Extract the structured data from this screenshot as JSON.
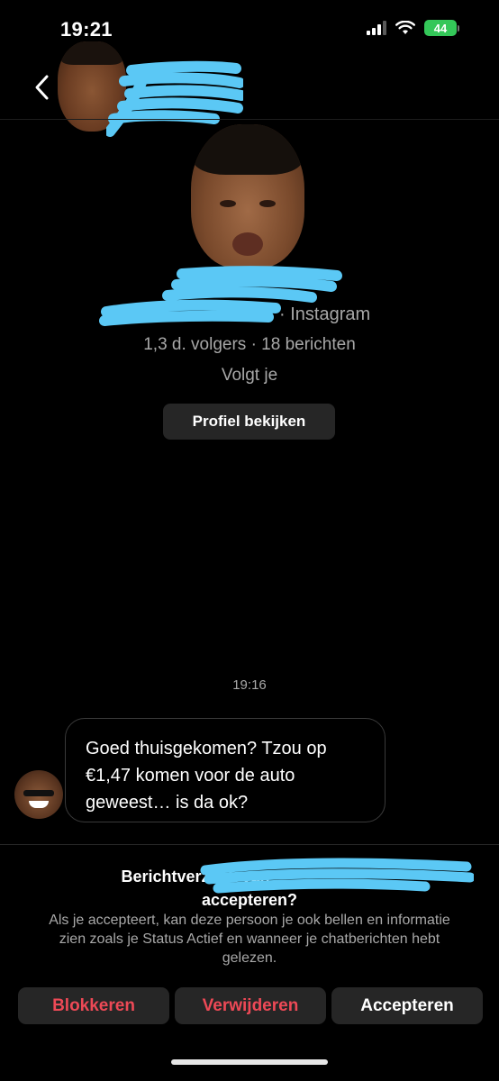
{
  "status_bar": {
    "time": "19:21",
    "battery": "44"
  },
  "profile": {
    "platform": "· Instagram",
    "stats": "1,3 d. volgers · 18 berichten",
    "follows_you": "Volgt je",
    "view_profile_label": "Profiel bekijken"
  },
  "chat": {
    "timestamp": "19:16",
    "message_lines": [
      "Goed thuisgekomen? Tzou op",
      "€1,47 komen voor de auto",
      "geweest… is da ok?"
    ]
  },
  "request": {
    "title_line1": "Berichtverzoek van",
    "title_line2": "accepteren?",
    "description": "Als je accepteert, kan deze persoon je ook bellen en informatie zien zoals je Status Actief en wanneer je chatberichten hebt gelezen.",
    "buttons": {
      "block": "Blokkeren",
      "delete": "Verwijderen",
      "accept": "Accepteren"
    }
  },
  "colors": {
    "background": "#000000",
    "danger": "#ed4956",
    "button_bg": "#262626",
    "battery": "#34c759",
    "redaction": "#5bc8f5"
  },
  "icons": {
    "back": "chevron-left-icon",
    "signal": "cellular-signal-icon",
    "wifi": "wifi-icon",
    "battery": "battery-icon"
  }
}
